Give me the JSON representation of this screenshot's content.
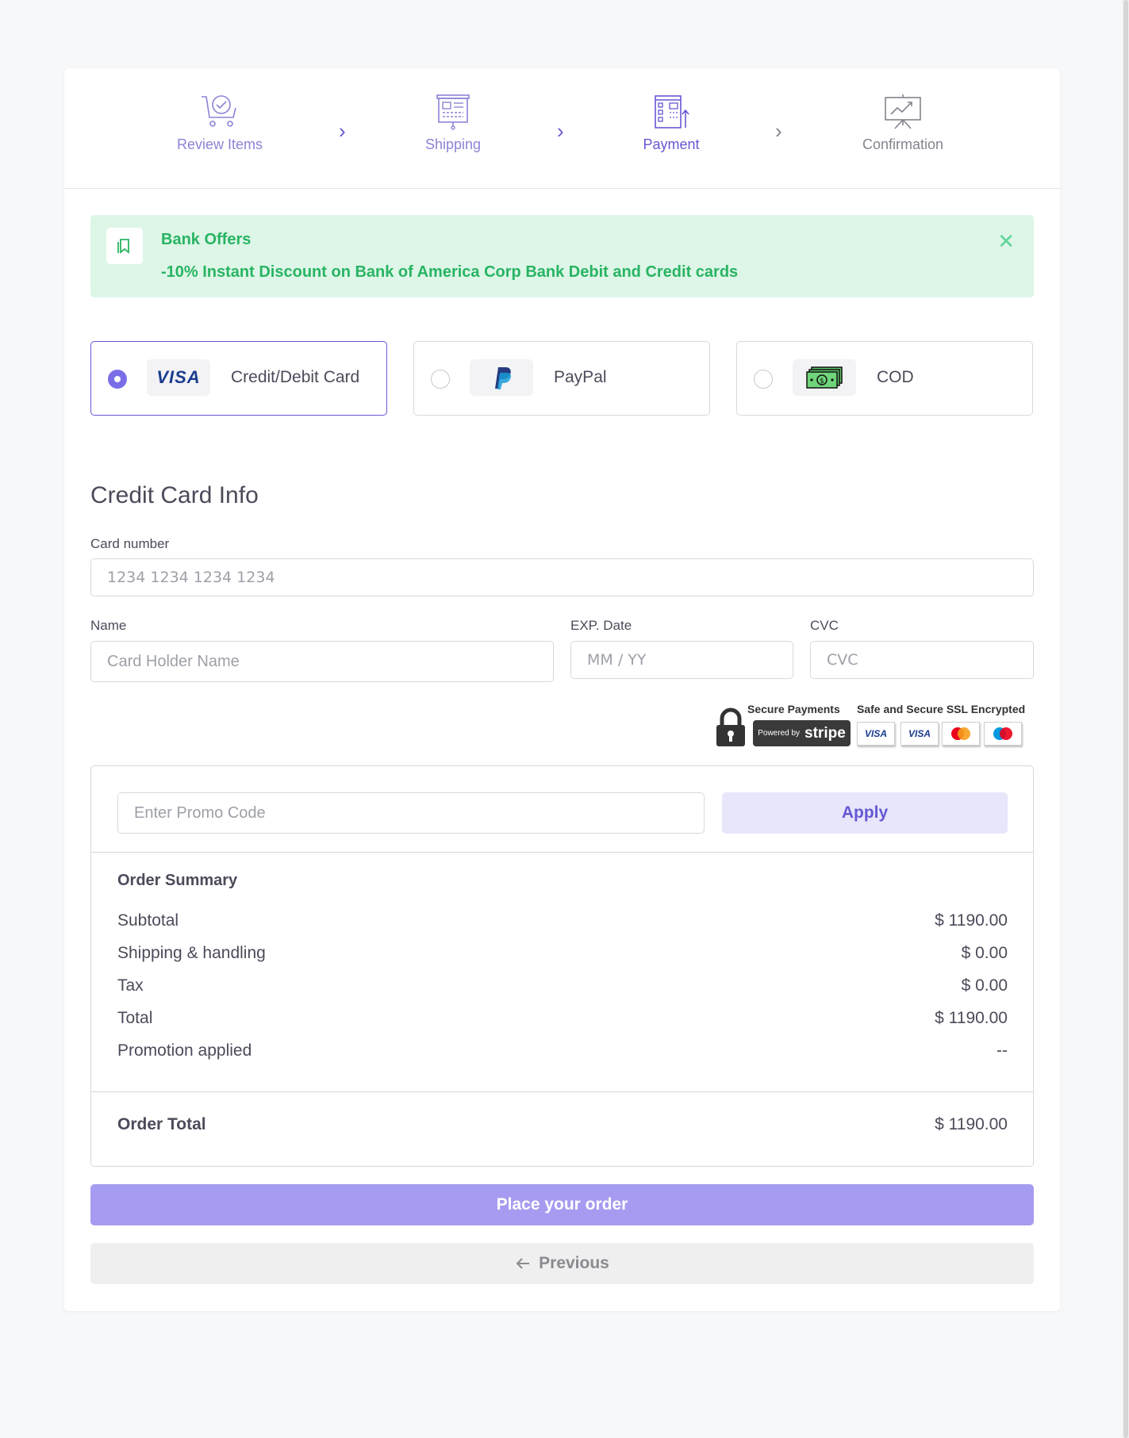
{
  "stepper": {
    "steps": [
      {
        "label": "Review Items",
        "icon": "cart-check-icon",
        "state": "done"
      },
      {
        "label": "Shipping",
        "icon": "presentation-board-icon",
        "state": "done"
      },
      {
        "label": "Payment",
        "icon": "payment-card-icon",
        "state": "active"
      },
      {
        "label": "Confirmation",
        "icon": "chart-board-icon",
        "state": "upcoming"
      }
    ],
    "separator_icon": "chevron-right-icon"
  },
  "offer": {
    "title": "Bank Offers",
    "text": "-10% Instant Discount on Bank of America Corp Bank Debit and Credit cards",
    "icon": "bookmark-icon",
    "close_icon": "close-icon"
  },
  "payment_methods": [
    {
      "label": "Credit/Debit Card",
      "logo": "visa-logo",
      "selected": true
    },
    {
      "label": "PayPal",
      "logo": "paypal-logo",
      "selected": false
    },
    {
      "label": "COD",
      "logo": "cash-icon",
      "selected": false
    }
  ],
  "card_form": {
    "title": "Credit Card Info",
    "card_number_label": "Card number",
    "card_number_placeholder": "1234 1234 1234 1234",
    "name_label": "Name",
    "name_placeholder": "Card Holder Name",
    "exp_label": "EXP. Date",
    "exp_placeholder": "MM / YY",
    "cvc_label": "CVC",
    "cvc_placeholder": "CVC"
  },
  "secure_badge": {
    "secure_title": "Secure Payments",
    "powered_by": "Powered by",
    "brand": "stripe",
    "ssl_title": "Safe and Secure SSL Encrypted",
    "cards": [
      "VISA",
      "VISA",
      "MasterCard",
      "Maestro"
    ],
    "icon": "lock-icon"
  },
  "promo": {
    "placeholder": "Enter Promo Code",
    "apply_label": "Apply"
  },
  "summary": {
    "heading": "Order Summary",
    "rows": [
      {
        "label": "Subtotal",
        "value": "$ 1190.00"
      },
      {
        "label": "Shipping & handling",
        "value": "$ 0.00"
      },
      {
        "label": "Tax",
        "value": "$ 0.00"
      },
      {
        "label": "Total",
        "value": "$ 1190.00"
      },
      {
        "label": "Promotion applied",
        "value": "--"
      }
    ],
    "order_total_label": "Order Total",
    "order_total_value": "$ 1190.00"
  },
  "actions": {
    "place_order": "Place your order",
    "previous": "Previous",
    "previous_icon": "arrow-left-icon"
  },
  "colors": {
    "accent": "#6558d3",
    "accent_light": "#a59cf1",
    "success": "#28b463",
    "success_bg": "#ddf6e7"
  }
}
